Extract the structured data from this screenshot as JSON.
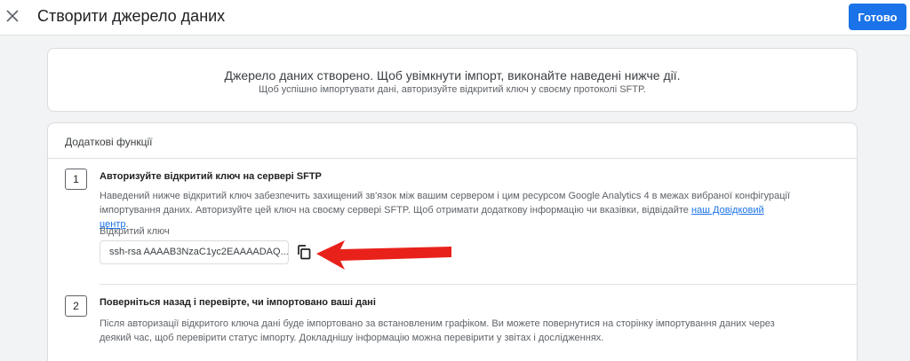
{
  "header": {
    "title": "Створити джерело даних",
    "done_label": "Готово"
  },
  "banner": {
    "title": "Джерело даних створено. Щоб увімкнути імпорт, виконайте наведені нижче дії.",
    "subtitle": "Щоб успішно імпортувати дані, авторизуйте відкритий ключ у своєму протоколі SFTP."
  },
  "card": {
    "title": "Додаткові функції",
    "steps": [
      {
        "number": "1",
        "title": "Авторизуйте відкритий ключ на сервері SFTP",
        "description": "Наведений нижче відкритий ключ забезпечить захищений зв'язок між вашим сервером і цим ресурсом Google Analytics 4 в межах вибраної конфігурації імпортування даних. Авторизуйте цей ключ на своєму сервері SFTP. Щоб отримати додаткову інформацію чи вказівки, відвідайте",
        "link_text": "наш Довідковий центр",
        "after_link": ".",
        "key_label": "Відкритий ключ",
        "key_value": "ssh-rsa AAAAB3NzaC1yc2EAAAADAQ..."
      },
      {
        "number": "2",
        "title": "Поверніться назад і перевірте, чи імпортовано ваші дані",
        "description": "Після авторизації відкритого ключа дані буде імпортовано за встановленим графіком. Ви можете повернутися на сторінку імпортування даних через деякий час, щоб перевірити статус імпорту. Докладнішу інформацію можна перевірити у звітах і дослідженнях."
      }
    ]
  },
  "icons": {
    "close": "close-icon",
    "copy": "copy-icon",
    "annotation": "red-arrow-annotation"
  },
  "colors": {
    "primary": "#1a73e8",
    "annotation": "#e8221b"
  }
}
